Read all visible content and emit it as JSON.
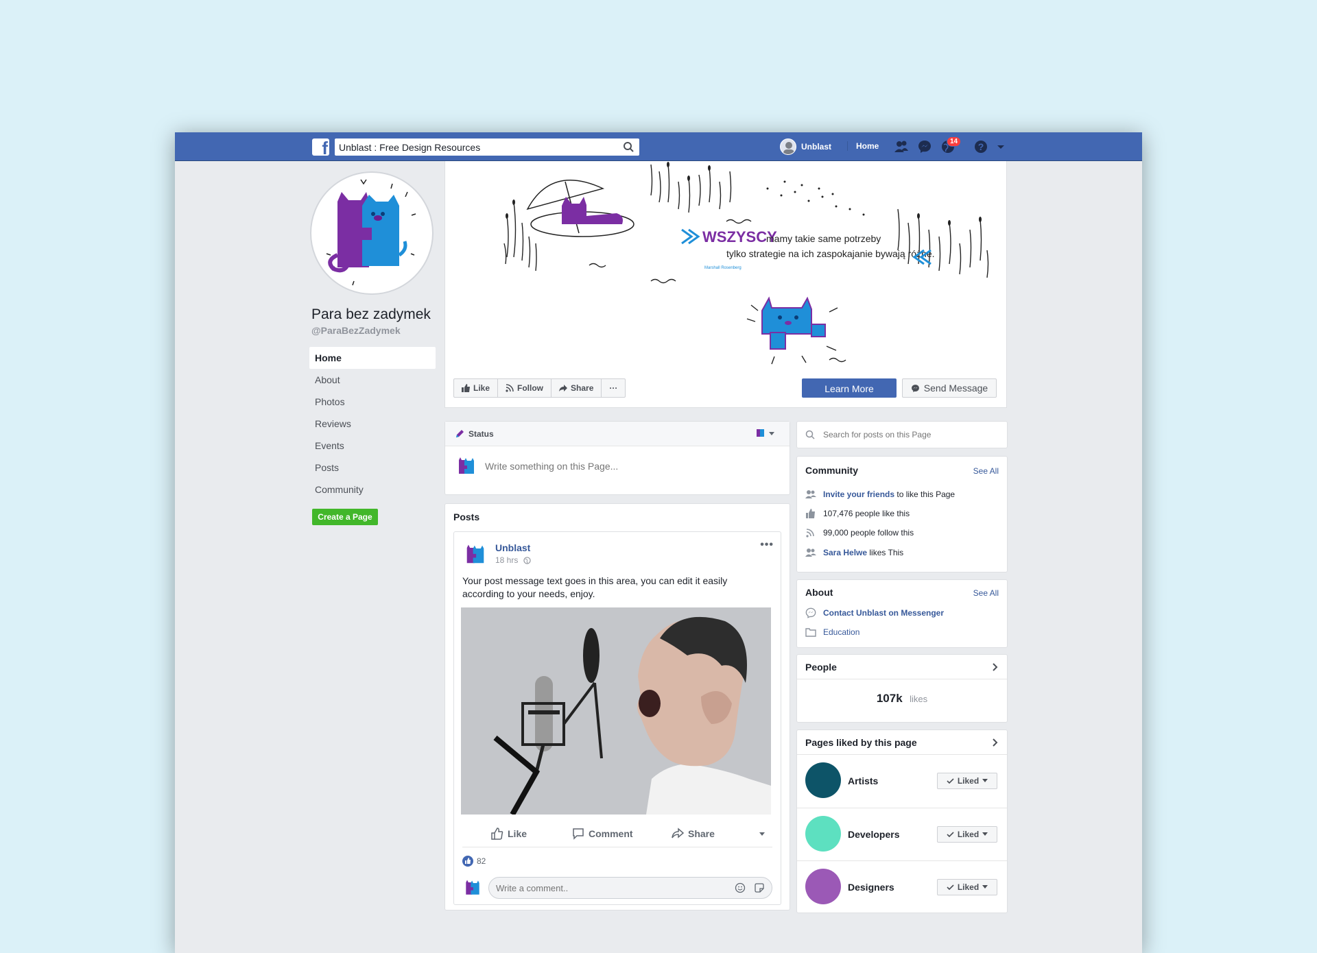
{
  "topbar": {
    "search_value": "Unblast : Free Design Resources",
    "user_name": "Unblast",
    "home_label": "Home",
    "notification_count": "14",
    "brand_color": "#4267b2"
  },
  "page": {
    "name": "Para bez zadymek",
    "handle": "@ParaBezZadymek"
  },
  "nav": {
    "items": [
      "Home",
      "About",
      "Photos",
      "Reviews",
      "Events",
      "Posts",
      "Community"
    ],
    "create_page": "Create a Page"
  },
  "cover": {
    "quote_word": "WSZYSCY",
    "quote_line1": "mamy takie same potrzeby",
    "quote_line2": "tylko strategie na ich zaspokajanie bywają różne.",
    "quote_author": "Marshall Rosenberg"
  },
  "actions": {
    "like": "Like",
    "follow": "Follow",
    "share": "Share",
    "more": "···",
    "learn_more": "Learn More",
    "send_message": "Send Message"
  },
  "composer": {
    "tab_label": "Status",
    "placeholder": "Write something on this Page..."
  },
  "posts": {
    "title": "Posts",
    "post": {
      "author": "Unblast",
      "time": "18 hrs",
      "text": "Your post message text goes in this area, you can edit it easily according to your needs, enjoy.",
      "like": "Like",
      "comment": "Comment",
      "share": "Share",
      "reaction_count": "82",
      "comment_placeholder": "Write a comment.."
    }
  },
  "sidebar": {
    "search_placeholder": "Search for posts on this Page",
    "community": {
      "title": "Community",
      "see_all": "See All",
      "invite_link": "Invite your friends",
      "invite_rest": "to like this Page",
      "likes": "107,476 people like this",
      "follows": "99,000 people follow this",
      "friend_name": "Sara Helwe",
      "friend_rest": "likes This"
    },
    "about": {
      "title": "About",
      "see_all": "See All",
      "messenger": "Contact Unblast on Messenger",
      "category": "Education"
    },
    "people": {
      "title": "People",
      "count": "107k",
      "unit": "likes"
    },
    "liked_pages": {
      "title": "Pages liked by this page",
      "button": "Liked",
      "items": [
        {
          "name": "Artists",
          "color": "#0d5468"
        },
        {
          "name": "Developers",
          "color": "#5de0c0"
        },
        {
          "name": "Designers",
          "color": "#9b59b6"
        }
      ]
    }
  }
}
